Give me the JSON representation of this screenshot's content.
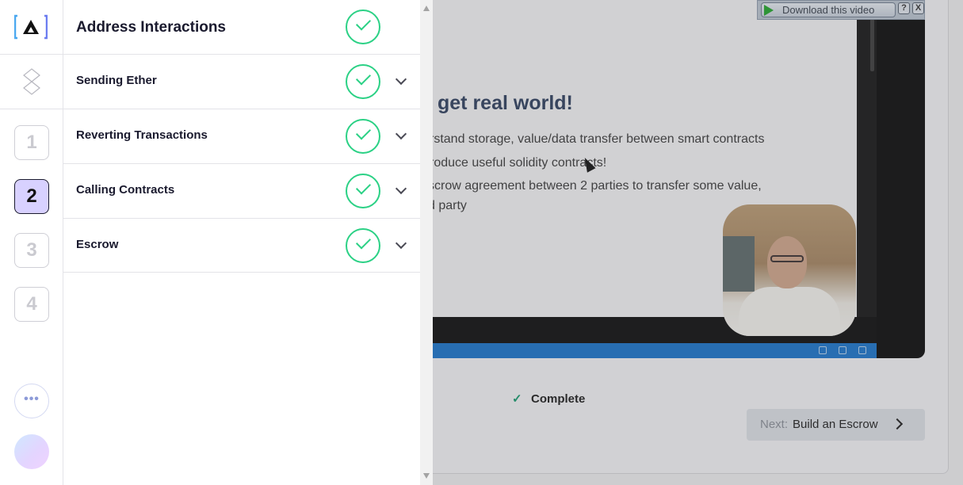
{
  "video": {
    "slide_title": "get real world!",
    "slide_lines": [
      "rstand storage, value/data transfer between smart contracts",
      "roduce useful solidity contracts!",
      "scrow agreement between 2 parties to transfer some value,",
      "d party"
    ],
    "download_label": "Download this video",
    "help_label": "?",
    "close_label": "X"
  },
  "footer": {
    "complete_icon": "check-icon",
    "complete_label": "Complete",
    "next_prefix": "Next:",
    "next_label": "Build an Escrow"
  },
  "rail": {
    "steps": [
      "1",
      "2",
      "3",
      "4"
    ],
    "active_step": "2",
    "more_label": "•••"
  },
  "panel": {
    "title": "Address Interactions",
    "lessons": [
      {
        "label": "Sending Ether",
        "status": "complete"
      },
      {
        "label": "Reverting Transactions",
        "status": "complete"
      },
      {
        "label": "Calling Contracts",
        "status": "complete"
      },
      {
        "label": "Escrow",
        "status": "complete"
      }
    ]
  },
  "colors": {
    "accent_green": "#2bd185",
    "active_step_bg": "#d8d1ff",
    "taskbar_blue": "#1a74c9"
  }
}
